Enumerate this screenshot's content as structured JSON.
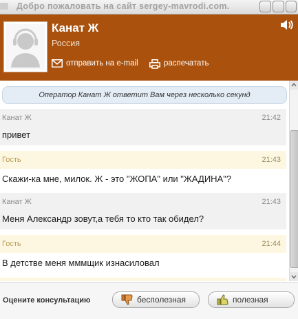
{
  "window": {
    "title": "Добро пожаловать на сайт sergey-mavrodi.com."
  },
  "header": {
    "operator_name": "Канат Ж",
    "operator_country": "Россия",
    "email_link": "отправить на e-mail",
    "print_link": "распечатать",
    "icons": [
      "avatar-placeholder",
      "sound-icon",
      "mail-icon",
      "printer-icon"
    ]
  },
  "chat": {
    "notice": "Оператор Канат Ж ответит Вам через несколько секунд",
    "messages": [
      {
        "author": "Канат Ж",
        "time": "21:42",
        "text": "привет",
        "role": "operator"
      },
      {
        "author": "Гость",
        "time": "21:43",
        "text": "Скажи-ка мне, милок. Ж - это \"ЖОПА\" или \"ЖАДИНА\"?",
        "role": "guest"
      },
      {
        "author": "Канат Ж",
        "time": "21:43",
        "text": "Меня Александр зовут,а тебя то кто так обидел?",
        "role": "operator"
      },
      {
        "author": "Гость",
        "time": "21:44",
        "text": "В детстве меня мммщик изнасиловал",
        "role": "guest"
      }
    ]
  },
  "footer": {
    "rate_label": "Оцените консультацию",
    "bad_label": "бесполезная",
    "good_label": "полезная"
  },
  "colors": {
    "header_bg": "#a9510d",
    "notice_bg": "#e4edf6",
    "operator_row_bg": "#f1f1f1",
    "guest_header_bg": "#fdf7e2"
  }
}
